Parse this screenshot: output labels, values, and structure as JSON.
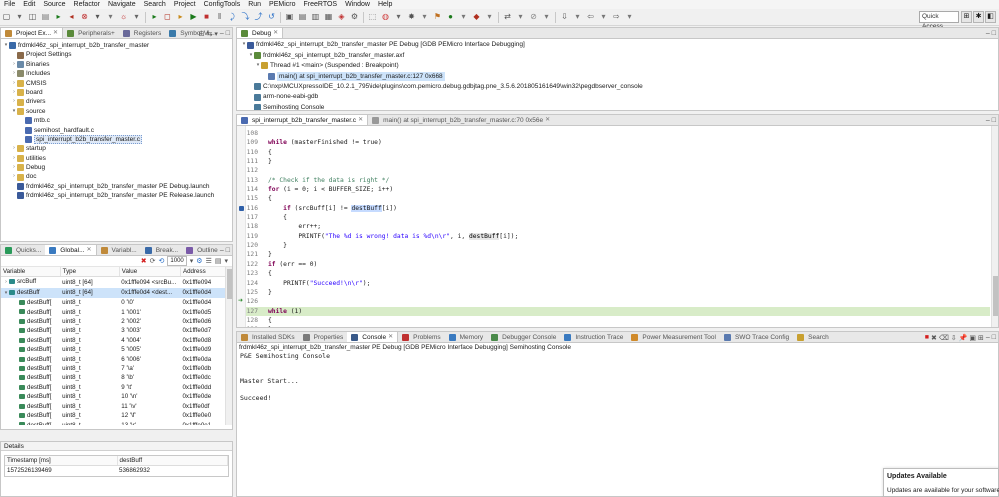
{
  "menu": [
    "File",
    "Edit",
    "Source",
    "Refactor",
    "Navigate",
    "Search",
    "Project",
    "ConfigTools",
    "Run",
    "PEMicro",
    "FreeRTOS",
    "Window",
    "Help"
  ],
  "toolbar": {
    "quick_access": "Quick Access"
  },
  "project_explorer": {
    "tabs": [
      "Project Ex...",
      "Peripherals+",
      "Registers",
      "Symbol Vi..."
    ],
    "items": [
      {
        "label": "frdmkl46z_spi_interrupt_b2b_transfer_master",
        "depth": 0,
        "expanded": true
      },
      {
        "label": "Project Settings",
        "depth": 1
      },
      {
        "label": "Binaries",
        "depth": 1
      },
      {
        "label": "Includes",
        "depth": 1
      },
      {
        "label": "CMSIS",
        "depth": 1
      },
      {
        "label": "board",
        "depth": 1
      },
      {
        "label": "drivers",
        "depth": 1
      },
      {
        "label": "source",
        "depth": 1,
        "expanded": true
      },
      {
        "label": "mtb.c",
        "depth": 2
      },
      {
        "label": "semihost_hardfault.c",
        "depth": 2
      },
      {
        "label": "spi_interrupt_b2b_transfer_master.c",
        "depth": 2,
        "selected": true
      },
      {
        "label": "startup",
        "depth": 1
      },
      {
        "label": "utilities",
        "depth": 1
      },
      {
        "label": "Debug",
        "depth": 1
      },
      {
        "label": "doc",
        "depth": 1
      },
      {
        "label": "frdmkl46z_spi_interrupt_b2b_transfer_master PE Debug.launch",
        "depth": 1
      },
      {
        "label": "frdmkl46z_spi_interrupt_b2b_transfer_master PE Release.launch",
        "depth": 1
      }
    ]
  },
  "variables": {
    "tabs": [
      "Quicks...",
      "Global...",
      "Variabl...",
      "Break...",
      "Outline"
    ],
    "filter_value": "1000",
    "columns": [
      "Variable",
      "Type",
      "Value",
      "Address"
    ],
    "rows": [
      {
        "name": "srcBuff",
        "type": "uint8_t [64]",
        "value": "0x1fffe094 <srcBu...",
        "address": "0x1fffe094",
        "depth": 0
      },
      {
        "name": "destBuff",
        "type": "uint8_t [64]",
        "value": "0x1fffe0d4 <dest...",
        "address": "0x1fffe0d4",
        "depth": 0,
        "expanded": true,
        "selected": true
      },
      {
        "name": "destBuff[",
        "type": "uint8_t",
        "value": "0 '\\0'",
        "address": "0x1fffe0d4",
        "depth": 1
      },
      {
        "name": "destBuff[",
        "type": "uint8_t",
        "value": "1 '\\001'",
        "address": "0x1fffe0d5",
        "depth": 1
      },
      {
        "name": "destBuff[",
        "type": "uint8_t",
        "value": "2 '\\002'",
        "address": "0x1fffe0d6",
        "depth": 1
      },
      {
        "name": "destBuff[",
        "type": "uint8_t",
        "value": "3 '\\003'",
        "address": "0x1fffe0d7",
        "depth": 1
      },
      {
        "name": "destBuff[",
        "type": "uint8_t",
        "value": "4 '\\004'",
        "address": "0x1fffe0d8",
        "depth": 1
      },
      {
        "name": "destBuff[",
        "type": "uint8_t",
        "value": "5 '\\005'",
        "address": "0x1fffe0d9",
        "depth": 1
      },
      {
        "name": "destBuff[",
        "type": "uint8_t",
        "value": "6 '\\006'",
        "address": "0x1fffe0da",
        "depth": 1
      },
      {
        "name": "destBuff[",
        "type": "uint8_t",
        "value": "7 '\\a'",
        "address": "0x1fffe0db",
        "depth": 1
      },
      {
        "name": "destBuff[",
        "type": "uint8_t",
        "value": "8 '\\b'",
        "address": "0x1fffe0dc",
        "depth": 1
      },
      {
        "name": "destBuff[",
        "type": "uint8_t",
        "value": "9 '\\t'",
        "address": "0x1fffe0dd",
        "depth": 1
      },
      {
        "name": "destBuff[",
        "type": "uint8_t",
        "value": "10 '\\n'",
        "address": "0x1fffe0de",
        "depth": 1
      },
      {
        "name": "destBuff[",
        "type": "uint8_t",
        "value": "11 '\\v'",
        "address": "0x1fffe0df",
        "depth": 1
      },
      {
        "name": "destBuff[",
        "type": "uint8_t",
        "value": "12 '\\f'",
        "address": "0x1fffe0e0",
        "depth": 1
      },
      {
        "name": "destBuff[",
        "type": "uint8_t",
        "value": "13 '\\r'",
        "address": "0x1fffe0e1",
        "depth": 1
      }
    ]
  },
  "details": {
    "title": "Details",
    "columns": [
      "Timestamp [ms]",
      "destBuff"
    ],
    "rows": [
      [
        "1572526139469",
        "536862932"
      ]
    ]
  },
  "debug": {
    "tab": "Debug",
    "items": [
      {
        "label": "frdmkl46z_spi_interrupt_b2b_transfer_master PE Debug [GDB PEMicro Interface Debugging]",
        "depth": 0
      },
      {
        "label": "frdmkl46z_spi_interrupt_b2b_transfer_master.axf",
        "depth": 1
      },
      {
        "label": "Thread #1 <main> (Suspended : Breakpoint)",
        "depth": 2
      },
      {
        "label": "main() at spi_interrupt_b2b_transfer_master.c:127 0x668",
        "depth": 3,
        "selected": true
      },
      {
        "label": "C:\\nxp\\MCUXpressoIDE_10.2.1_795\\ide\\plugins\\com.pemicro.debug.gdbjtag.pne_3.5.6.201805161649\\win32\\pegdbserver_console",
        "depth": 1
      },
      {
        "label": "arm-none-eabi-gdb",
        "depth": 1
      },
      {
        "label": "Semihosting Console",
        "depth": 1
      }
    ]
  },
  "editor": {
    "tabs": [
      "spi_interrupt_b2b_transfer_master.c",
      "main() at spi_interrupt_b2b_transfer_master.c:70 0x56e"
    ],
    "lines": [
      {
        "n": "108",
        "code": ""
      },
      {
        "n": "109",
        "code": "while (masterFinished != true)"
      },
      {
        "n": "110",
        "code": "{"
      },
      {
        "n": "111",
        "code": "}"
      },
      {
        "n": "112",
        "code": ""
      },
      {
        "n": "113",
        "code": "/* Check if the data is right */"
      },
      {
        "n": "114",
        "code": "for (i = 0; i < BUFFER_SIZE; i++)"
      },
      {
        "n": "115",
        "code": "{"
      },
      {
        "n": "116",
        "code": "    if (srcBuff[i] != destBuff[i])"
      },
      {
        "n": "117",
        "code": "    {"
      },
      {
        "n": "118",
        "code": "        err++;"
      },
      {
        "n": "119",
        "code": "        PRINTF(\"The %d is wrong! data is %d\\n\\r\", i, destBuff[i]);"
      },
      {
        "n": "120",
        "code": "    }"
      },
      {
        "n": "121",
        "code": "}"
      },
      {
        "n": "122",
        "code": "if (err == 0)"
      },
      {
        "n": "123",
        "code": "{"
      },
      {
        "n": "124",
        "code": "    PRINTF(\"Succeed!\\n\\r\");"
      },
      {
        "n": "125",
        "code": "}"
      },
      {
        "n": "126",
        "code": ""
      },
      {
        "n": "127",
        "code": "while (1)"
      },
      {
        "n": "128",
        "code": "{"
      },
      {
        "n": "129",
        "code": "}"
      },
      {
        "n": "130",
        "code": "}"
      },
      {
        "n": "131",
        "code": ""
      }
    ]
  },
  "console": {
    "tabs": [
      "Installed SDKs",
      "Properties",
      "Console",
      "Problems",
      "Memory",
      "Debugger Console",
      "Instruction Trace",
      "Power Measurement Tool",
      "SWO Trace Config",
      "Search"
    ],
    "header": "frdmkl46z_spi_interrupt_b2b_transfer_master PE Debug [GDB PEMicro Interface Debugging] Semihosting Console",
    "lines": [
      "P&E Semihosting Console",
      "",
      "",
      "Master Start...",
      "",
      "Succeed!"
    ]
  },
  "notification": {
    "title": "Updates Available",
    "body": "Updates are available for your software."
  }
}
